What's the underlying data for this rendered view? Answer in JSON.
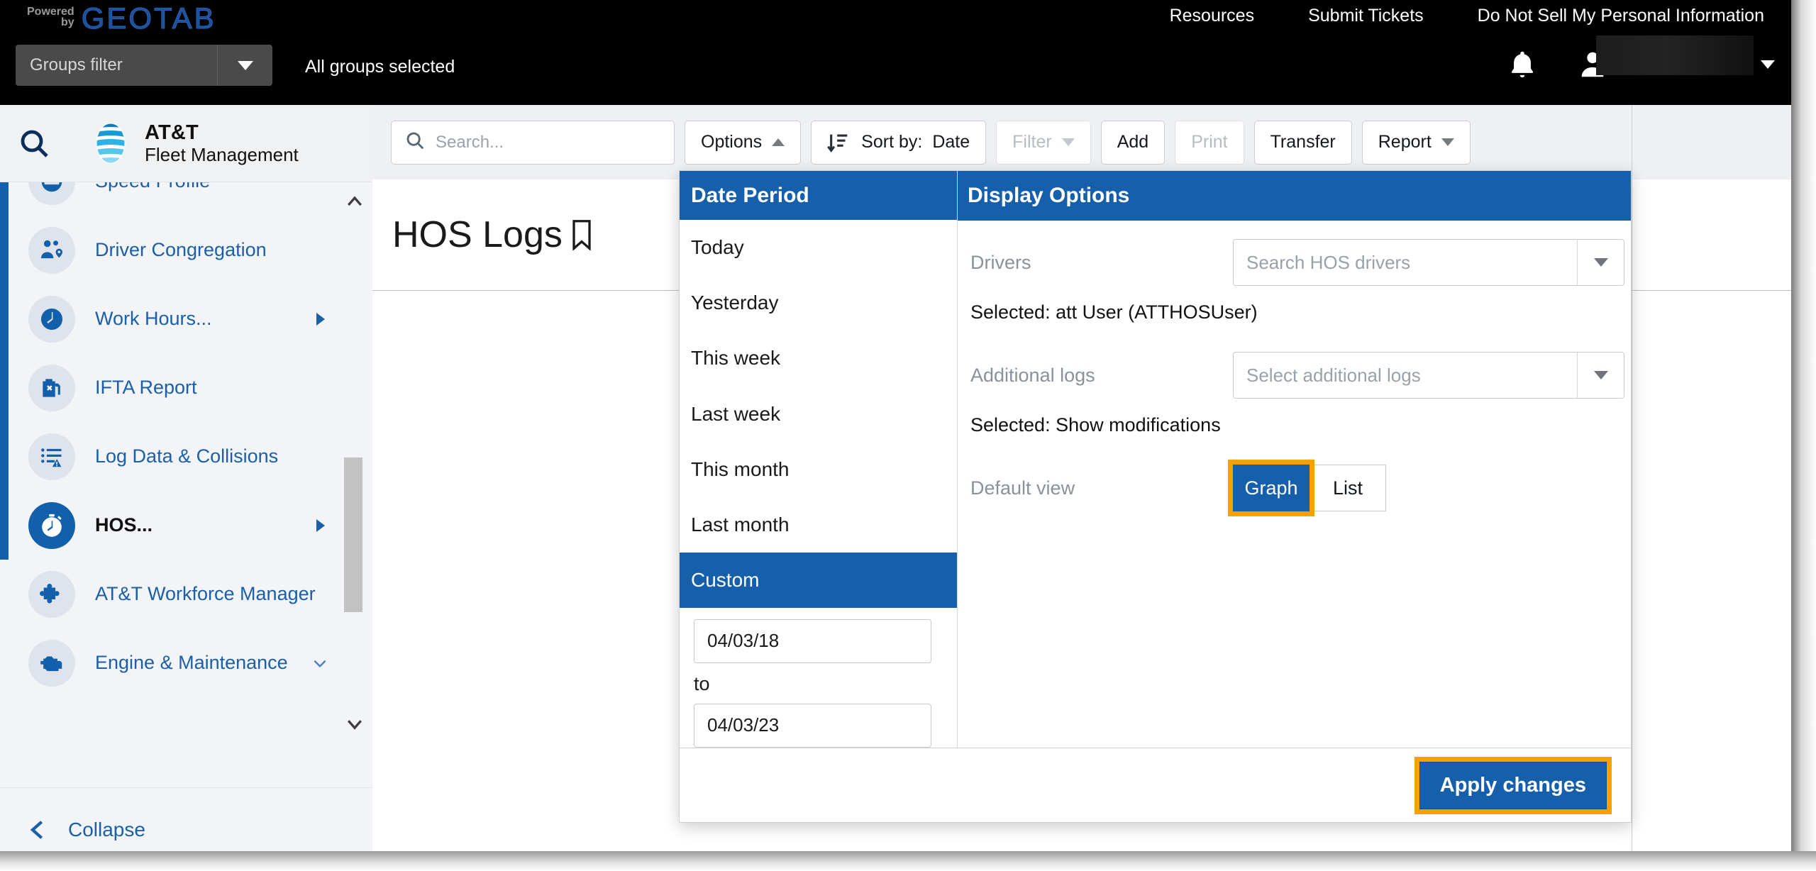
{
  "brand": {
    "powered_line1": "Powered",
    "powered_line2": "by",
    "geotab": "GEOTAB",
    "att_line1": "AT&T",
    "att_line2": "Fleet Management"
  },
  "globalbar": {
    "groups_filter_placeholder": "Groups filter",
    "groups_status": "All groups selected",
    "links": [
      {
        "label": "Resources"
      },
      {
        "label": "Submit Tickets"
      },
      {
        "label": "Do Not Sell My Personal Information"
      }
    ],
    "bell_icon": "notification-bell-icon",
    "user_icon": "user-avatar-icon",
    "user_name": ""
  },
  "sidebar": {
    "search_icon": "search-icon",
    "items": [
      {
        "label": "Speed Profile",
        "icon": "speedometer-icon",
        "has_submenu": false,
        "selected": false
      },
      {
        "label": "Driver Congregation",
        "icon": "people-location-icon",
        "has_submenu": false,
        "selected": false
      },
      {
        "label": "Work Hours...",
        "icon": "clock-icon",
        "has_submenu": true,
        "selected": false
      },
      {
        "label": "IFTA Report",
        "icon": "fuel-can-icon",
        "has_submenu": false,
        "selected": false
      },
      {
        "label": "Log Data & Collisions",
        "icon": "list-warning-icon",
        "has_submenu": false,
        "selected": false
      },
      {
        "label": "HOS...",
        "icon": "stopwatch-icon",
        "has_submenu": true,
        "selected": true
      },
      {
        "label": "AT&T Workforce Manager",
        "icon": "puzzle-piece-icon",
        "has_submenu": false,
        "selected": false
      },
      {
        "label": "Engine & Maintenance",
        "icon": "engine-icon",
        "has_chevron": true,
        "selected": false
      }
    ],
    "collapse_label": "Collapse",
    "collapse_icon": "chevron-left-icon"
  },
  "toolbar": {
    "search_placeholder": "Search...",
    "search_icon": "search-icon",
    "options_label": "Options",
    "options_caret": "caret-up-icon",
    "sort_icon": "sort-descending-icon",
    "sort_label": "Sort by:",
    "sort_value": "Date",
    "filter_label": "Filter",
    "add_label": "Add",
    "print_label": "Print",
    "transfer_label": "Transfer",
    "report_label": "Report"
  },
  "page": {
    "title": "HOS Logs",
    "bookmark_icon": "bookmark-icon"
  },
  "options_panel": {
    "date_period": {
      "header": "Date Period",
      "items": [
        {
          "label": "Today",
          "selected": false
        },
        {
          "label": "Yesterday",
          "selected": false
        },
        {
          "label": "This week",
          "selected": false
        },
        {
          "label": "Last week",
          "selected": false
        },
        {
          "label": "This month",
          "selected": false
        },
        {
          "label": "Last month",
          "selected": false
        },
        {
          "label": "Custom",
          "selected": true
        }
      ],
      "from_value": "04/03/18",
      "to_label": "to",
      "to_value": "04/03/23"
    },
    "display_options": {
      "header": "Display Options",
      "drivers_label": "Drivers",
      "drivers_placeholder": "Search HOS drivers",
      "drivers_selected": "Selected: att User (ATTHOSUser)",
      "additional_logs_label": "Additional logs",
      "additional_logs_placeholder": "Select additional logs",
      "additional_logs_selected": "Selected: Show modifications",
      "default_view_label": "Default view",
      "view_graph": "Graph",
      "view_list": "List",
      "view_active": "Graph"
    },
    "apply_label": "Apply changes"
  },
  "colors": {
    "brand_blue": "#1660ab",
    "highlight_orange": "#f5a201",
    "link_blue": "#1a5fa8",
    "black_bar": "#000000"
  }
}
